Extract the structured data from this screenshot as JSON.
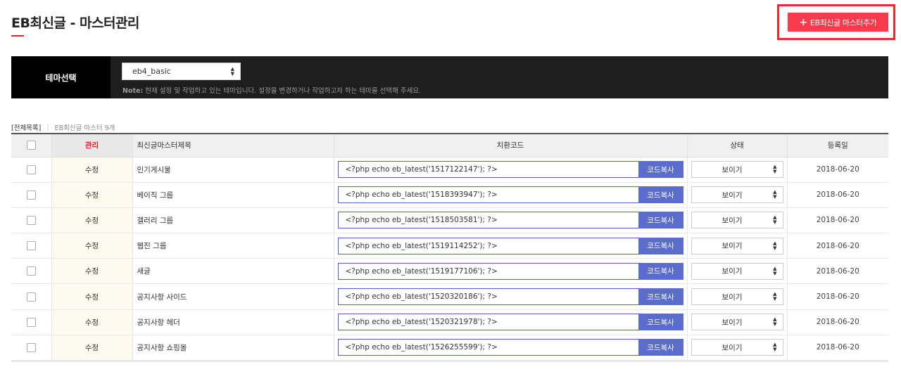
{
  "header": {
    "title": "EB최신글 - 마스터관리",
    "add_button_label": "EB최신글 마스터추가",
    "add_button_icon": "plus-icon"
  },
  "theme": {
    "label": "테마선택",
    "selected": "eb4_basic",
    "note_prefix": "Note:",
    "note_text": " 현재 설정 및 작업하고 있는 테마입니다. 설정을 변경하거나 작업하고자 하는 테마를 선택해 주세요."
  },
  "list_meta": {
    "all_label": "[전체목록]",
    "count_label": "EB최신글 마스터 9개"
  },
  "table": {
    "headers": {
      "manage": "관리",
      "title": "최신글마스터제목",
      "code": "치환코드",
      "status": "상태",
      "date": "등록일"
    },
    "edit_label": "수정",
    "copy_label": "코드복사",
    "rows": [
      {
        "title": "인기게시물",
        "code": "<?php echo eb_latest('1517122147'); ?>",
        "status": "보이기",
        "date": "2018-06-20"
      },
      {
        "title": "베이직 그룹",
        "code": "<?php echo eb_latest('1518393947'); ?>",
        "status": "보이기",
        "date": "2018-06-20"
      },
      {
        "title": "갤러리 그룹",
        "code": "<?php echo eb_latest('1518503581'); ?>",
        "status": "보이기",
        "date": "2018-06-20"
      },
      {
        "title": "웹진 그룹",
        "code": "<?php echo eb_latest('1519114252'); ?>",
        "status": "보이기",
        "date": "2018-06-20"
      },
      {
        "title": "새글",
        "code": "<?php echo eb_latest('1519177106'); ?>",
        "status": "보이기",
        "date": "2018-06-20"
      },
      {
        "title": "공지사항 사이드",
        "code": "<?php echo eb_latest('1520320186'); ?>",
        "status": "보이기",
        "date": "2018-06-20"
      },
      {
        "title": "공지사항 헤더",
        "code": "<?php echo eb_latest('1520321978'); ?>",
        "status": "보이기",
        "date": "2018-06-20"
      },
      {
        "title": "공지사항 쇼핑몰",
        "code": "<?php echo eb_latest('1526255599'); ?>",
        "status": "보이기",
        "date": "2018-06-20"
      }
    ]
  },
  "colors": {
    "accent_red": "#fb3b4b",
    "code_button_blue": "#5a6ccc",
    "theme_bar_bg": "#1e1e1e"
  }
}
